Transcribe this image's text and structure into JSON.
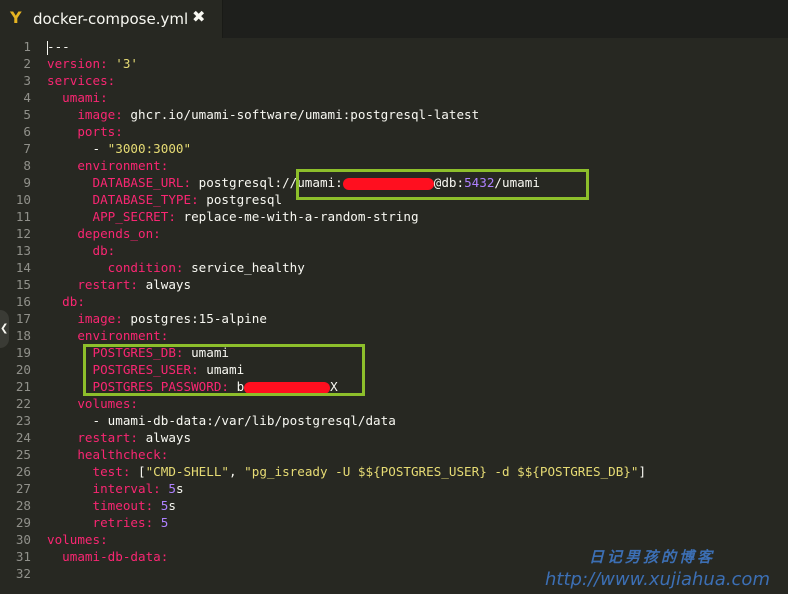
{
  "tab": {
    "icon": "yaml-file-icon",
    "logo_glyph": "Y",
    "title": "docker-compose.yml",
    "close_glyph": "✖"
  },
  "colors": {
    "background": "#272822",
    "key": "#f92672",
    "string": "#e6db74",
    "number": "#ae81ff",
    "plain": "#f8f8f2",
    "highlight_box": "#8dbf2b",
    "redaction": "#ff0f1f"
  },
  "lines": [
    {
      "n": "1",
      "parts": [
        {
          "t": "cursor"
        },
        {
          "t": "p",
          "v": "---"
        }
      ]
    },
    {
      "n": "2",
      "parts": [
        {
          "t": "k",
          "v": "version:"
        },
        {
          "t": "p",
          "v": " "
        },
        {
          "t": "s",
          "v": "'3'"
        }
      ]
    },
    {
      "n": "3",
      "parts": [
        {
          "t": "k",
          "v": "services:"
        }
      ]
    },
    {
      "n": "4",
      "parts": [
        {
          "t": "p",
          "v": "  "
        },
        {
          "t": "k",
          "v": "umami:"
        }
      ]
    },
    {
      "n": "5",
      "parts": [
        {
          "t": "p",
          "v": "    "
        },
        {
          "t": "k",
          "v": "image:"
        },
        {
          "t": "p",
          "v": " ghcr.io/umami-software/umami:postgresql-latest"
        }
      ]
    },
    {
      "n": "6",
      "parts": [
        {
          "t": "p",
          "v": "    "
        },
        {
          "t": "k",
          "v": "ports:"
        }
      ]
    },
    {
      "n": "7",
      "parts": [
        {
          "t": "p",
          "v": "      - "
        },
        {
          "t": "s",
          "v": "\"3000:3000\""
        }
      ]
    },
    {
      "n": "8",
      "parts": [
        {
          "t": "p",
          "v": "    "
        },
        {
          "t": "k",
          "v": "environment:"
        }
      ]
    },
    {
      "n": "9",
      "parts": [
        {
          "t": "p",
          "v": "      "
        },
        {
          "t": "k",
          "v": "DATABASE_URL:"
        },
        {
          "t": "p",
          "v": " postgresql://umami:"
        },
        {
          "t": "redact",
          "w": 91
        },
        {
          "t": "p",
          "v": "@db:"
        },
        {
          "t": "n",
          "v": "5432"
        },
        {
          "t": "p",
          "v": "/umami"
        }
      ]
    },
    {
      "n": "10",
      "parts": [
        {
          "t": "p",
          "v": "      "
        },
        {
          "t": "k",
          "v": "DATABASE_TYPE:"
        },
        {
          "t": "p",
          "v": " postgresql"
        }
      ]
    },
    {
      "n": "11",
      "parts": [
        {
          "t": "p",
          "v": "      "
        },
        {
          "t": "k",
          "v": "APP_SECRET:"
        },
        {
          "t": "p",
          "v": " replace-me-with-a-random-string"
        }
      ]
    },
    {
      "n": "12",
      "parts": [
        {
          "t": "p",
          "v": "    "
        },
        {
          "t": "k",
          "v": "depends_on:"
        }
      ]
    },
    {
      "n": "13",
      "parts": [
        {
          "t": "p",
          "v": "      "
        },
        {
          "t": "k",
          "v": "db:"
        }
      ]
    },
    {
      "n": "14",
      "parts": [
        {
          "t": "p",
          "v": "        "
        },
        {
          "t": "k",
          "v": "condition:"
        },
        {
          "t": "p",
          "v": " service_healthy"
        }
      ]
    },
    {
      "n": "15",
      "parts": [
        {
          "t": "p",
          "v": "    "
        },
        {
          "t": "k",
          "v": "restart:"
        },
        {
          "t": "p",
          "v": " always"
        }
      ]
    },
    {
      "n": "16",
      "parts": [
        {
          "t": "p",
          "v": "  "
        },
        {
          "t": "k",
          "v": "db:"
        }
      ]
    },
    {
      "n": "17",
      "parts": [
        {
          "t": "p",
          "v": "    "
        },
        {
          "t": "k",
          "v": "image:"
        },
        {
          "t": "p",
          "v": " postgres:15-alpine"
        }
      ]
    },
    {
      "n": "18",
      "parts": [
        {
          "t": "p",
          "v": "    "
        },
        {
          "t": "k",
          "v": "environment:"
        }
      ]
    },
    {
      "n": "19",
      "parts": [
        {
          "t": "p",
          "v": "      "
        },
        {
          "t": "k",
          "v": "POSTGRES_DB:"
        },
        {
          "t": "p",
          "v": " umami"
        }
      ]
    },
    {
      "n": "20",
      "parts": [
        {
          "t": "p",
          "v": "      "
        },
        {
          "t": "k",
          "v": "POSTGRES_USER:"
        },
        {
          "t": "p",
          "v": " umami"
        }
      ]
    },
    {
      "n": "21",
      "parts": [
        {
          "t": "p",
          "v": "      "
        },
        {
          "t": "k",
          "v": "POSTGRES_PASSWORD:"
        },
        {
          "t": "p",
          "v": " b"
        },
        {
          "t": "redact",
          "w": 86
        },
        {
          "t": "p",
          "v": "X"
        }
      ]
    },
    {
      "n": "22",
      "parts": [
        {
          "t": "p",
          "v": "    "
        },
        {
          "t": "k",
          "v": "volumes:"
        }
      ]
    },
    {
      "n": "23",
      "parts": [
        {
          "t": "p",
          "v": "      - umami-db-data:/var/lib/postgresql/data"
        }
      ]
    },
    {
      "n": "24",
      "parts": [
        {
          "t": "p",
          "v": "    "
        },
        {
          "t": "k",
          "v": "restart:"
        },
        {
          "t": "p",
          "v": " always"
        }
      ]
    },
    {
      "n": "25",
      "parts": [
        {
          "t": "p",
          "v": "    "
        },
        {
          "t": "k",
          "v": "healthcheck:"
        }
      ]
    },
    {
      "n": "26",
      "parts": [
        {
          "t": "p",
          "v": "      "
        },
        {
          "t": "k",
          "v": "test:"
        },
        {
          "t": "p",
          "v": " ["
        },
        {
          "t": "s",
          "v": "\"CMD-SHELL\""
        },
        {
          "t": "p",
          "v": ", "
        },
        {
          "t": "s",
          "v": "\"pg_isready -U $${POSTGRES_USER} -d $${POSTGRES_DB}\""
        },
        {
          "t": "p",
          "v": "]"
        }
      ]
    },
    {
      "n": "27",
      "parts": [
        {
          "t": "p",
          "v": "      "
        },
        {
          "t": "k",
          "v": "interval:"
        },
        {
          "t": "p",
          "v": " "
        },
        {
          "t": "n",
          "v": "5"
        },
        {
          "t": "p",
          "v": "s"
        }
      ]
    },
    {
      "n": "28",
      "parts": [
        {
          "t": "p",
          "v": "      "
        },
        {
          "t": "k",
          "v": "timeout:"
        },
        {
          "t": "p",
          "v": " "
        },
        {
          "t": "n",
          "v": "5"
        },
        {
          "t": "p",
          "v": "s"
        }
      ]
    },
    {
      "n": "29",
      "parts": [
        {
          "t": "p",
          "v": "      "
        },
        {
          "t": "k",
          "v": "retries:"
        },
        {
          "t": "p",
          "v": " "
        },
        {
          "t": "n",
          "v": "5"
        }
      ]
    },
    {
      "n": "30",
      "parts": [
        {
          "t": "k",
          "v": "volumes:"
        }
      ]
    },
    {
      "n": "31",
      "parts": [
        {
          "t": "p",
          "v": "  "
        },
        {
          "t": "k",
          "v": "umami-db-data:"
        }
      ]
    },
    {
      "n": "32",
      "parts": []
    }
  ],
  "sidebar_toggle": {
    "glyph": "❮",
    "icon": "chevron-left-icon"
  },
  "watermark": {
    "chinese": "日记男孩的博客",
    "url": "http://www.xujiahua.com"
  }
}
